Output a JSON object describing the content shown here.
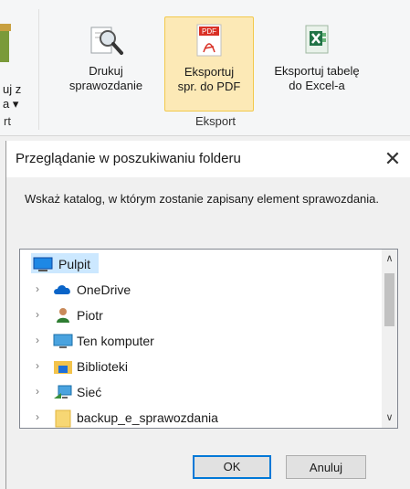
{
  "ribbon": {
    "partial_button": {
      "line1": "uj z",
      "line2": "a ▾"
    },
    "print_report": {
      "line1": "Drukuj",
      "line2": "sprawozdanie"
    },
    "export_pdf": {
      "line1": "Eksportuj",
      "line2": "spr. do PDF",
      "icon_text": "PDF"
    },
    "export_excel": {
      "line1": "Eksportuj tabelę",
      "line2": "do Excel-a"
    },
    "partial_group": "rt",
    "export_group": "Eksport"
  },
  "dialog": {
    "title": "Przeglądanie w poszukiwaniu folderu",
    "close_glyph": "✕",
    "description": "Wskaż katalog, w którym zostanie zapisany element sprawozdania.",
    "tree": [
      {
        "label": "Pulpit",
        "icon": "desktop-icon",
        "selected": true
      },
      {
        "label": "OneDrive",
        "icon": "cloud-icon"
      },
      {
        "label": "Piotr",
        "icon": "user-icon"
      },
      {
        "label": "Ten komputer",
        "icon": "computer-icon"
      },
      {
        "label": "Biblioteki",
        "icon": "library-icon"
      },
      {
        "label": "Sieć",
        "icon": "network-icon"
      },
      {
        "label": "backup_e_sprawozdania",
        "icon": "folder-icon"
      }
    ],
    "chevron": "›",
    "ok": "OK",
    "cancel": "Anuluj"
  },
  "colors": {
    "selection": "#cce8ff",
    "accent": "#0078d7",
    "ribbon_active": "#fce9b6"
  }
}
